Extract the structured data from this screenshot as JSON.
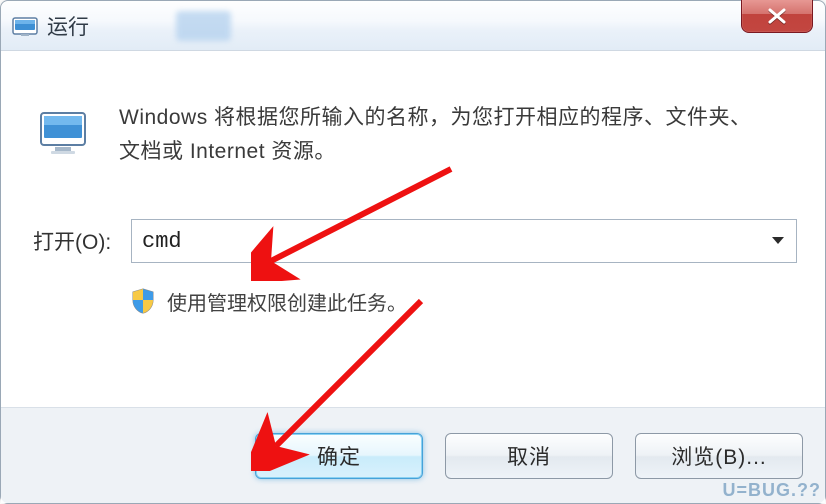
{
  "window": {
    "title": "运行",
    "close_label": "关闭"
  },
  "body": {
    "description": "Windows 将根据您所输入的名称，为您打开相应的程序、文件夹、文档或 Internet 资源。",
    "open_label": "打开(O):",
    "open_value": "cmd",
    "admin_note": "使用管理权限创建此任务。"
  },
  "footer": {
    "ok": "确定",
    "cancel": "取消",
    "browse": "浏览(B)..."
  },
  "watermark": "U=BUG.??",
  "icons": {
    "window": "run-dialog-icon",
    "close": "close-icon",
    "run": "run-program-icon",
    "shield": "uac-shield-icon",
    "dropdown": "chevron-down-icon"
  }
}
